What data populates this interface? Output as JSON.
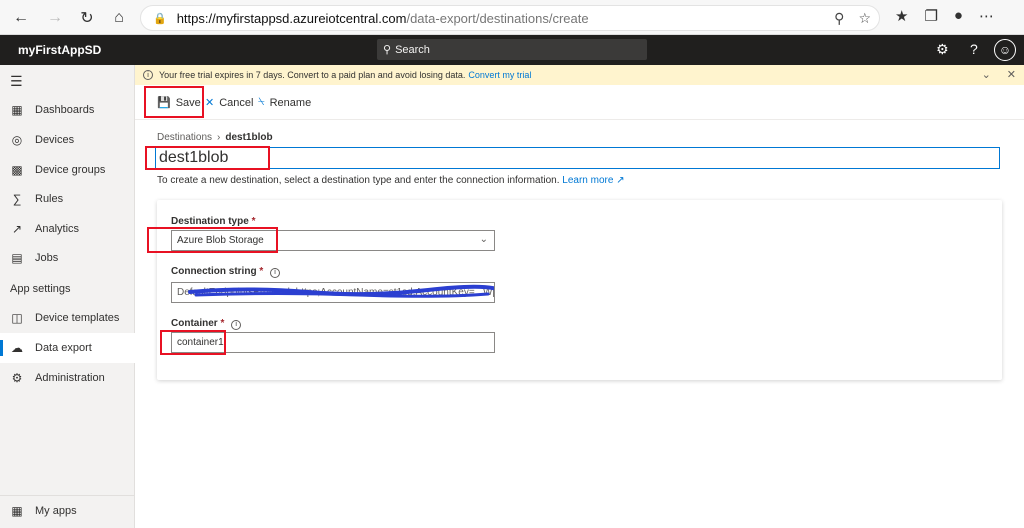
{
  "browser": {
    "url_host": "https://myfirstappsd.azureiotcentral.com",
    "url_path": "/data-export/destinations/create"
  },
  "app": {
    "title": "myFirstAppSD",
    "search_placeholder": "Search"
  },
  "banner": {
    "text": "Your free trial expires in 7 days. Convert to a paid plan and avoid losing data.",
    "link": "Convert my trial"
  },
  "sidebar": {
    "items": [
      {
        "label": "Dashboards",
        "icon": "dashboard-icon"
      },
      {
        "label": "Devices",
        "icon": "devices-icon"
      },
      {
        "label": "Device groups",
        "icon": "device-groups-icon"
      },
      {
        "label": "Rules",
        "icon": "rules-icon"
      },
      {
        "label": "Analytics",
        "icon": "analytics-icon"
      },
      {
        "label": "Jobs",
        "icon": "jobs-icon"
      }
    ],
    "section": "App settings",
    "settings_items": [
      {
        "label": "Device templates",
        "icon": "device-templates-icon"
      },
      {
        "label": "Data export",
        "icon": "data-export-icon"
      },
      {
        "label": "Administration",
        "icon": "administration-icon"
      }
    ],
    "bottom_item": {
      "label": "My apps",
      "icon": "my-apps-icon"
    }
  },
  "toolbar": {
    "save_label": "Save",
    "cancel_label": "Cancel",
    "rename_label": "Rename"
  },
  "breadcrumb": {
    "parent": "Destinations",
    "current": "dest1blob"
  },
  "form": {
    "name_value": "dest1blob",
    "helper_text": "To create a new destination, select a destination type and enter the connection information.",
    "learn_more": "Learn more",
    "destination_type_label": "Destination type",
    "destination_type_value": "Azure Blob Storage",
    "connection_string_label": "Connection string",
    "connection_string_value": "DefaultEndpointsProtocol=https;AccountName=st1sd;AccountKey=...Wpg...",
    "container_label": "Container",
    "container_value": "container1",
    "required_mark": "*"
  },
  "colors": {
    "accent": "#0078d4",
    "header_bg": "#201f1e",
    "highlight_box": "#e81123",
    "banner_bg": "#fff4ce"
  }
}
